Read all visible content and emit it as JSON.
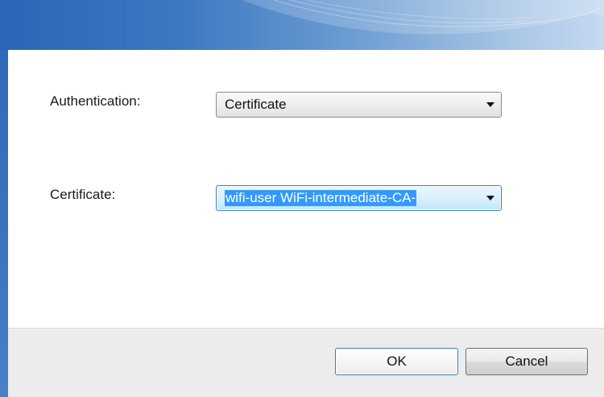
{
  "dialog": {
    "authentication_label": "Authentication:",
    "authentication_value": "Certificate",
    "certificate_label": "Certificate:",
    "certificate_value": "wifi-user WiFi-intermediate-CA-",
    "ok_label": "OK",
    "cancel_label": "Cancel"
  },
  "colors": {
    "title_bar_start": "#2a66b6",
    "title_bar_end": "#c6daf0",
    "selection_highlight": "#3399ff",
    "footer_background": "#ececec"
  },
  "icons": {
    "dropdown": "chevron-down-icon"
  }
}
